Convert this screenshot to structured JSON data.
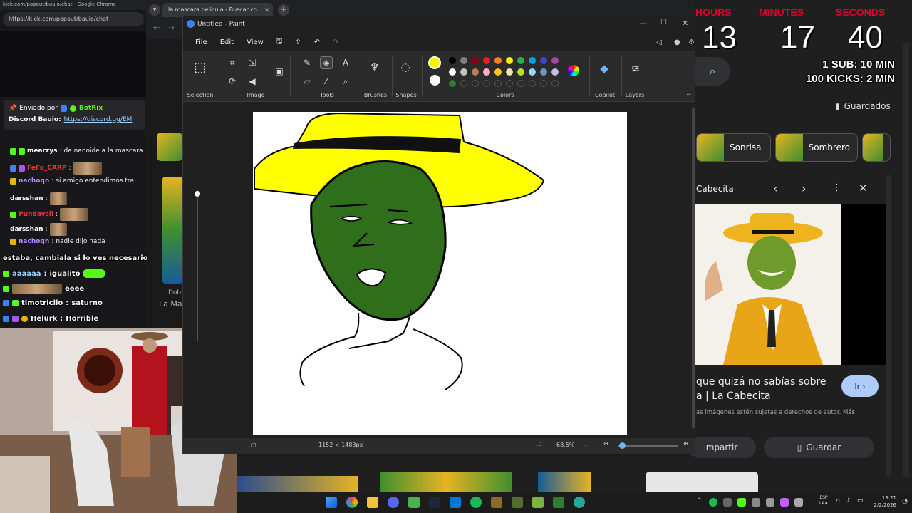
{
  "kick": {
    "title": "kick.com/popout/bauio/chat - Google Chrome",
    "url": "https://kick.com/popout/bauio/chat",
    "pinned_by": "Enviado por",
    "pinned_user": "BotRix",
    "pinned_prefix": "Discord Bauio:",
    "pinned_link": "https://discord.gg/EM"
  },
  "chat": [
    {
      "user": "mearzys",
      "text": "de nanoide a la mascara",
      "color": "#ffffff"
    },
    {
      "user": "FeFo_CARP",
      "text": "",
      "color": "#e33b3b"
    },
    {
      "user": "nachoqn",
      "text": "si amigo entendimos tra",
      "color": "#b48cff"
    },
    {
      "user": "darsshan",
      "text": "",
      "color": "#ffffff"
    },
    {
      "user": "Pundaysil",
      "text": "",
      "color": "#e33b3b"
    },
    {
      "user": "darsshan",
      "text": "",
      "color": "#ffffff"
    },
    {
      "user": "nachoqn",
      "text": "nadie dijo nada",
      "color": "#b48cff"
    }
  ],
  "overlay_chat": [
    {
      "user": "",
      "text": "estaba, cambiala si lo ves necesario"
    },
    {
      "user": "",
      "text": "igualito"
    },
    {
      "user": "",
      "text": "eeee"
    },
    {
      "user": "timotriciio",
      "text": "saturno"
    },
    {
      "user": "Helurk",
      "text": "Horrible"
    }
  ],
  "browser2": {
    "tab_title": "la mascara pelicula - Buscar co"
  },
  "timer": {
    "hours_label": "HOURS",
    "minutes_label": "MINUTES",
    "seconds_label": "SECONDS",
    "hours": "13",
    "minutes": "17",
    "seconds": "40",
    "rule1": "1 SUB: 10 MIN",
    "rule2": "100 KICKS: 2 MIN"
  },
  "gimages": {
    "saved": "Guardados",
    "chip1": "Sonrisa",
    "chip2": "Sombrero",
    "source": "Cabecita",
    "desc_line1": "que quizá no sabías sobre",
    "desc_line2": "a | La Cabecita",
    "go_button": "Ir",
    "copyright": "as imágenes estén sujetas a derechos de autor.",
    "more": "Más",
    "share_button": "mpartir",
    "save_button": "Guardar",
    "left_label1": "Dob",
    "left_label2": "La Ma"
  },
  "paint": {
    "window_title": "Untitled - Paint",
    "menu": [
      "File",
      "Edit",
      "View"
    ],
    "groups": {
      "selection": "Selection",
      "image": "Image",
      "tools": "Tools",
      "brushes": "Brushes",
      "shapes": "Shapes",
      "colors": "Colors",
      "copilot": "Copilot",
      "layers": "Layers"
    },
    "palette": [
      "#000000",
      "#7f7f7f",
      "#880015",
      "#ed1c24",
      "#ff7f27",
      "#fff200",
      "#22b14c",
      "#00a2e8",
      "#3f48cc",
      "#a349a4",
      "#ffffff",
      "#c3c3c3",
      "#b97a57",
      "#ffaec9",
      "#ffc90e",
      "#efe4b0",
      "#b5e61d",
      "#99d9ea",
      "#7092be",
      "#c8bfe7",
      "#2e7d32"
    ],
    "primary_color": "#fff200",
    "secondary_color": "#ffffff",
    "dimensions": "1152 × 1483px",
    "zoom": "68.5%"
  },
  "taskbar": {
    "lang1": "ESP",
    "lang2": "LAA",
    "time": "13:21",
    "date": "2/2/2026"
  },
  "icons": [
    "search-icon",
    "gear-icon",
    "close-icon",
    "undo-icon",
    "redo-icon",
    "save-icon",
    "pencil-icon",
    "fill-icon",
    "text-icon",
    "eraser-icon",
    "picker-icon",
    "magnifier-icon",
    "brush-icon",
    "shapes-icon",
    "layers-icon",
    "copilot-icon",
    "share-icon",
    "bookmark-icon",
    "chevron-left-icon",
    "chevron-right-icon",
    "more-icon"
  ]
}
